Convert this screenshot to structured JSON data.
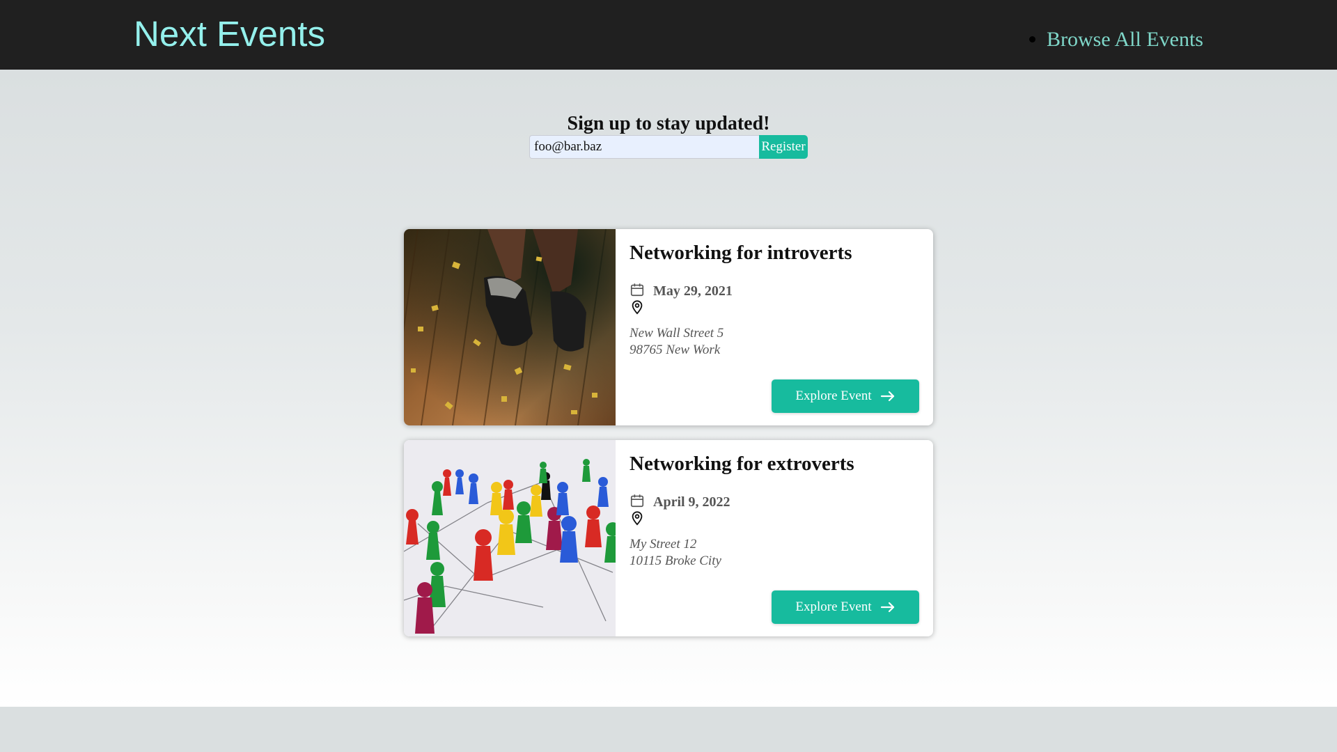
{
  "header": {
    "logo": "Next Events",
    "nav": [
      {
        "label": "Browse All Events"
      }
    ]
  },
  "signup": {
    "title": "Sign up to stay updated!",
    "email_value": "foo@bar.baz",
    "button_label": "Register"
  },
  "events": [
    {
      "title": "Networking for introverts",
      "date": "May 29, 2021",
      "address_line1": "New Wall Street 5",
      "address_line2": "98765 New Work",
      "button_label": "Explore Event",
      "image": "photo of boots on a wooden floor with gold confetti"
    },
    {
      "title": "Networking for extroverts",
      "date": "April 9, 2022",
      "address_line1": "My Street 12",
      "address_line2": "10115 Broke City",
      "button_label": "Explore Event",
      "image": "photo of colorful game pawns connected by lines"
    }
  ],
  "icons": {
    "date": "calendar-icon",
    "location": "location-pin-icon",
    "explore": "arrow-right-icon"
  },
  "colors": {
    "header_bg": "#202020",
    "logo": "#94f0ec",
    "nav_link": "#7fd7c9",
    "accent": "#17bb9e"
  }
}
